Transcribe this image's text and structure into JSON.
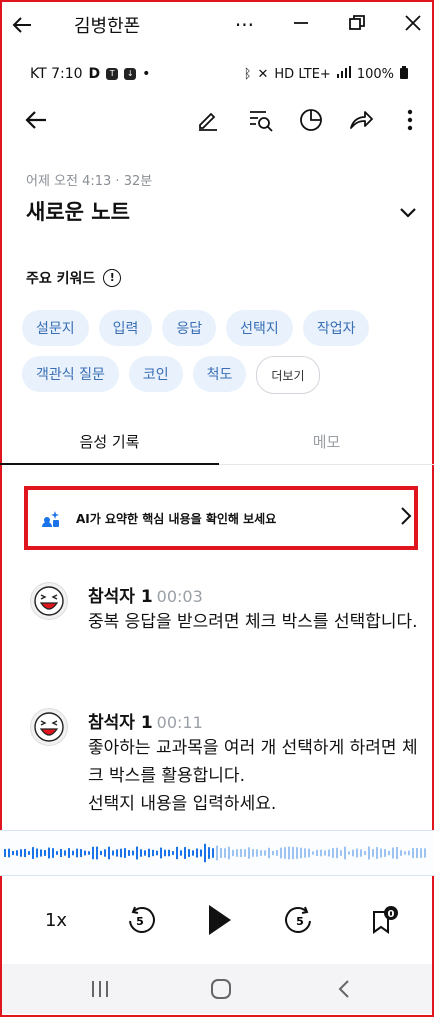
{
  "window": {
    "title": "김병한폰",
    "more_label": "···"
  },
  "status_bar": {
    "carrier_time": "KT 7:10",
    "indicators": "D",
    "network": "HD LTE+",
    "battery": "100%"
  },
  "toolbar": {
    "icons": [
      "back-icon",
      "edit-icon",
      "search-list-icon",
      "summary-icon",
      "share-icon",
      "more-vertical-icon"
    ]
  },
  "note": {
    "meta": "어제 오전 4:13 · 32분",
    "title": "새로운 노트"
  },
  "keywords": {
    "label": "주요 키워드",
    "items": [
      "설문지",
      "입력",
      "응답",
      "선택지",
      "작업자",
      "객관식 질문",
      "코인",
      "척도"
    ],
    "more": "더보기"
  },
  "tabs": {
    "voice": "음성 기록",
    "memo": "메모"
  },
  "ai_banner": {
    "text": "AI가 요약한 핵심 내용을 확인해 보세요"
  },
  "transcript": [
    {
      "speaker": "참석자 1",
      "time": "00:03",
      "text": "중복 응답을 받으려면 체크 박스를 선택합니다."
    },
    {
      "speaker": "참석자 1",
      "time": "00:11",
      "text": "좋아하는 교과목을 여러 개 선택하게 하려면 체크 박스를 활용합니다.\n선택지 내용을 입력하세요."
    }
  ],
  "player": {
    "speed": "1x",
    "rewind_seconds": "5",
    "forward_seconds": "5",
    "bookmark_count": "0"
  },
  "colors": {
    "frame_highlight": "#e0161e",
    "chip_bg": "#e8f1fc",
    "chip_text": "#3a6fb5",
    "accent": "#1a73e8"
  }
}
